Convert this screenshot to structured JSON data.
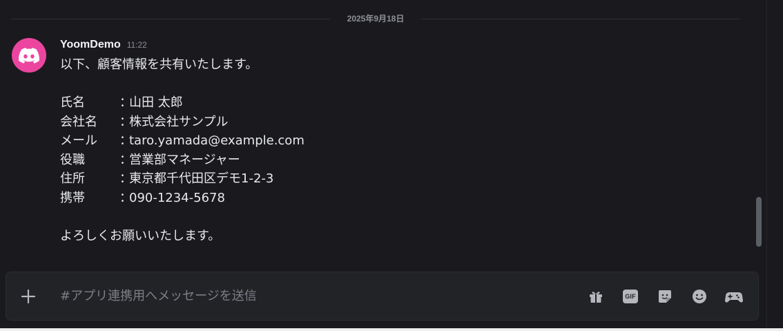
{
  "date_divider": "2025年9月18日",
  "message": {
    "author": "YoomDemo",
    "timestamp": "11:22",
    "intro": "以下、顧客情報を共有いたします。",
    "fields": [
      {
        "label": "氏名",
        "colon": "：",
        "value": "山田 太郎"
      },
      {
        "label": "会社名",
        "colon": "：",
        "value": "株式会社サンプル"
      },
      {
        "label": "メール",
        "colon": "：",
        "value": "taro.yamada@example.com"
      },
      {
        "label": "役職",
        "colon": "：",
        "value": "営業部マネージャー"
      },
      {
        "label": "住所",
        "colon": "：",
        "value": "東京都千代田区デモ1-2-3"
      },
      {
        "label": "携帯",
        "colon": "：",
        "value": "090-1234-5678"
      }
    ],
    "closing": "よろしくお願いいたします。"
  },
  "composer": {
    "placeholder": "#アプリ連携用へメッセージを送信",
    "value": "",
    "gif_label": "GIF",
    "tools": [
      "gift-icon",
      "gif-icon",
      "sticker-icon",
      "emoji-icon",
      "apps-icon"
    ]
  },
  "colors": {
    "background": "#1a1a1e",
    "avatar": "#eb459f",
    "composer": "#222327",
    "text": "#e8e9ec",
    "muted": "#8e9097",
    "icon": "#b5b7bd"
  }
}
